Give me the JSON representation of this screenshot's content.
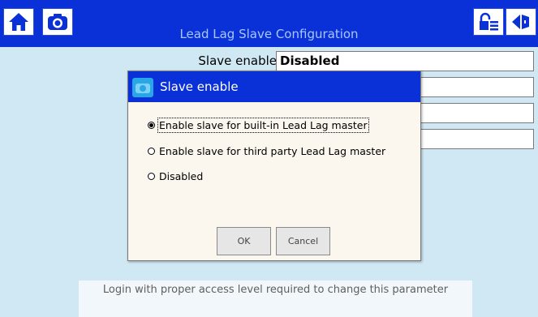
{
  "app": {
    "title": "Lead Lag Slave Configuration"
  },
  "toolbar": {
    "left_icons": [
      "home-icon",
      "camera-icon"
    ],
    "right_icons": [
      "login-icon",
      "back-icon"
    ]
  },
  "fields": [
    {
      "label": "Slave enable",
      "value": "Disabled"
    },
    {
      "label": "",
      "value": ""
    },
    {
      "label": "",
      "value": ""
    },
    {
      "label": "",
      "value": ""
    }
  ],
  "dialog": {
    "title": "Slave enable",
    "options": [
      {
        "label": "Enable slave for built-in Lead Lag master",
        "selected": true
      },
      {
        "label": "Enable slave for third party Lead Lag master",
        "selected": false
      },
      {
        "label": "Disabled",
        "selected": false
      }
    ],
    "ok_label": "OK",
    "cancel_label": "Cancel"
  },
  "notice": {
    "text": "Login with proper access level required to change this parameter"
  },
  "colors": {
    "accent": "#0a31d8",
    "background": "#cfe8f4"
  }
}
